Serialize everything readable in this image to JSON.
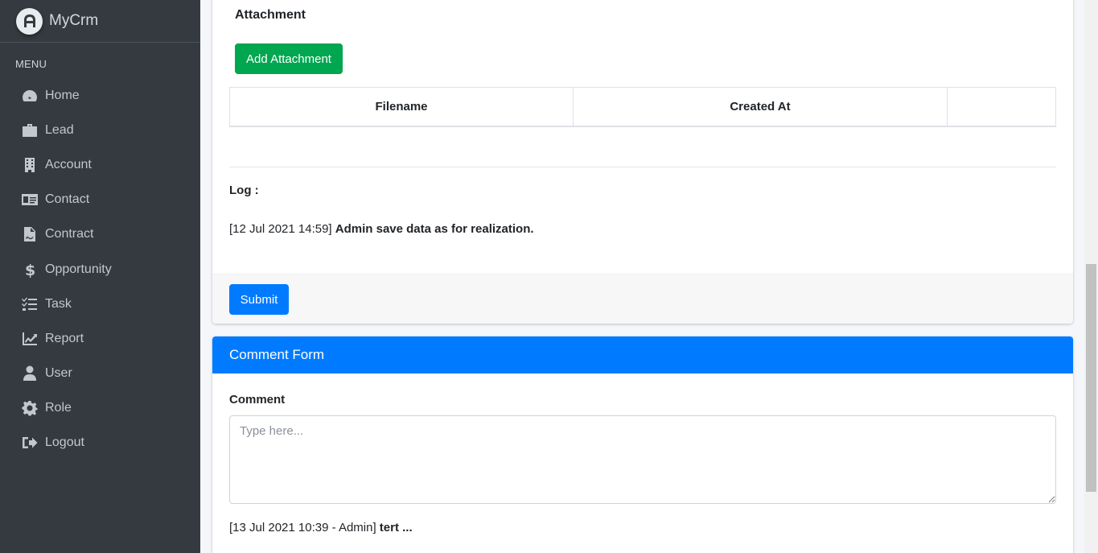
{
  "brand": {
    "name": "MyCrm"
  },
  "sidebar": {
    "menu_header": "MENU",
    "items": [
      {
        "label": "Home",
        "icon": "dashboard-icon"
      },
      {
        "label": "Lead",
        "icon": "briefcase-icon"
      },
      {
        "label": "Account",
        "icon": "building-icon"
      },
      {
        "label": "Contact",
        "icon": "address-card-icon"
      },
      {
        "label": "Contract",
        "icon": "file-contract-icon"
      },
      {
        "label": "Opportunity",
        "icon": "dollar-icon"
      },
      {
        "label": "Task",
        "icon": "tasks-icon"
      },
      {
        "label": "Report",
        "icon": "chart-line-icon"
      },
      {
        "label": "User",
        "icon": "user-icon"
      },
      {
        "label": "Role",
        "icon": "gear-icon"
      },
      {
        "label": "Logout",
        "icon": "sign-out-icon"
      }
    ]
  },
  "attachment": {
    "title": "Attachment",
    "add_button": "Add Attachment",
    "columns": [
      "Filename",
      "Created At",
      ""
    ]
  },
  "log": {
    "title": "Log :",
    "entry_meta": "[12 Jul 2021 14:59]",
    "entry_text": "Admin save data as for realization."
  },
  "footer": {
    "submit_label": "Submit"
  },
  "comment_form": {
    "header": "Comment Form",
    "label": "Comment",
    "placeholder": "Type here...",
    "entry_meta": "[13 Jul 2021 10:39 - Admin]",
    "entry_text": "tert ..."
  },
  "colors": {
    "sidebar_bg": "#343a40",
    "primary": "#007bff",
    "success": "#00a650"
  }
}
